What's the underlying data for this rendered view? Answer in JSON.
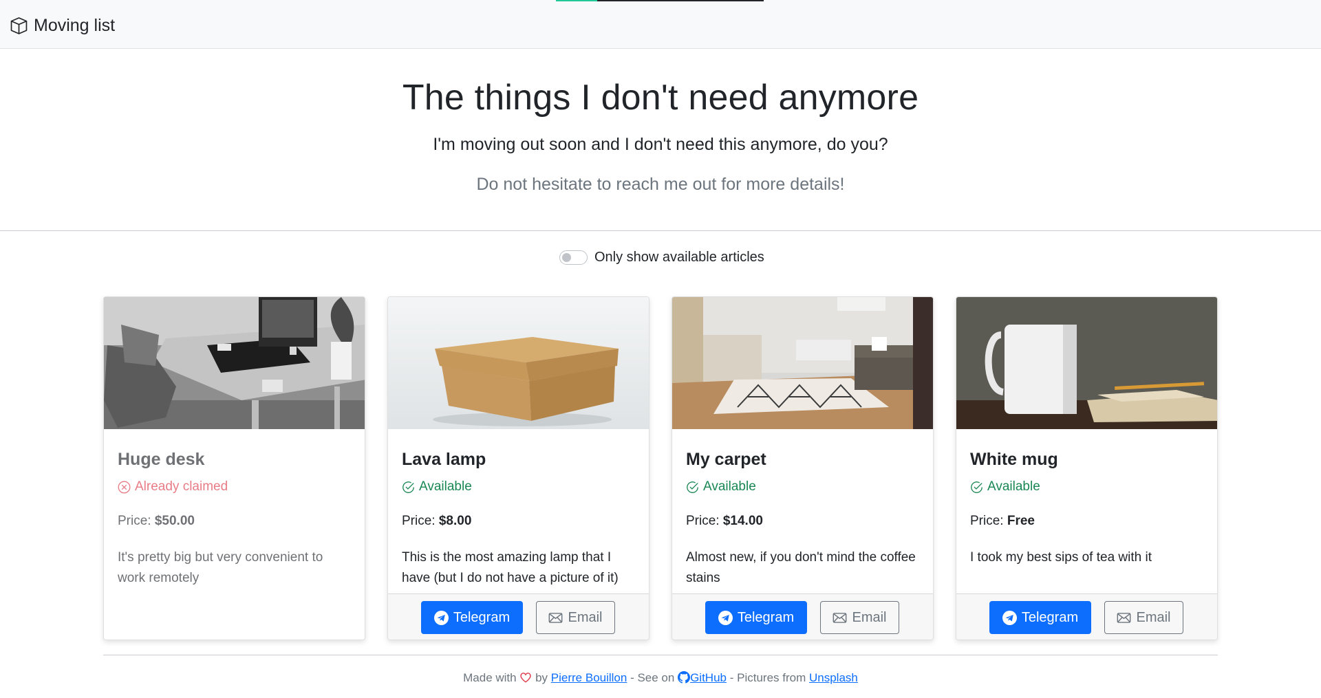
{
  "navbar": {
    "brand": "Moving list",
    "progress_fraction": 0.2
  },
  "hero": {
    "title": "The things I don't need anymore",
    "lead": "I'm moving out soon and I don't need this anymore, do you?",
    "muted": "Do not hesitate to reach me out for more details!"
  },
  "filter": {
    "label": "Only show available articles",
    "checked": false
  },
  "cards": [
    {
      "title": "Huge desk",
      "status": "Already claimed",
      "available": false,
      "price_label": "Price:",
      "price": "$50.00",
      "description": "It's pretty big but very convenient to work remotely",
      "image": "desk-photo"
    },
    {
      "title": "Lava lamp",
      "status": "Available",
      "available": true,
      "price_label": "Price:",
      "price": "$8.00",
      "description": "This is the most amazing lamp that I have (but I do not have a picture of it)",
      "image": "cardboard-box-photo",
      "telegram_label": "Telegram",
      "email_label": "Email"
    },
    {
      "title": "My carpet",
      "status": "Available",
      "available": true,
      "price_label": "Price:",
      "price": "$14.00",
      "description": "Almost new, if you don't mind the coffee stains",
      "image": "living-room-carpet-photo",
      "telegram_label": "Telegram",
      "email_label": "Email"
    },
    {
      "title": "White mug",
      "status": "Available",
      "available": true,
      "price_label": "Price:",
      "price": "Free",
      "description": "I took my best sips of tea with it",
      "image": "white-mug-photo",
      "telegram_label": "Telegram",
      "email_label": "Email"
    }
  ],
  "footer": {
    "made_with": "Made with",
    "by": "by",
    "author": "Pierre Bouillon",
    "see_on": "- See on",
    "github": "GitHub",
    "pictures_from": "- Pictures from",
    "unsplash": "Unsplash"
  },
  "colors": {
    "primary": "#0d6efd",
    "success": "#198754",
    "danger": "#dc3545",
    "muted": "#6c757d",
    "progress": "#20c997"
  }
}
